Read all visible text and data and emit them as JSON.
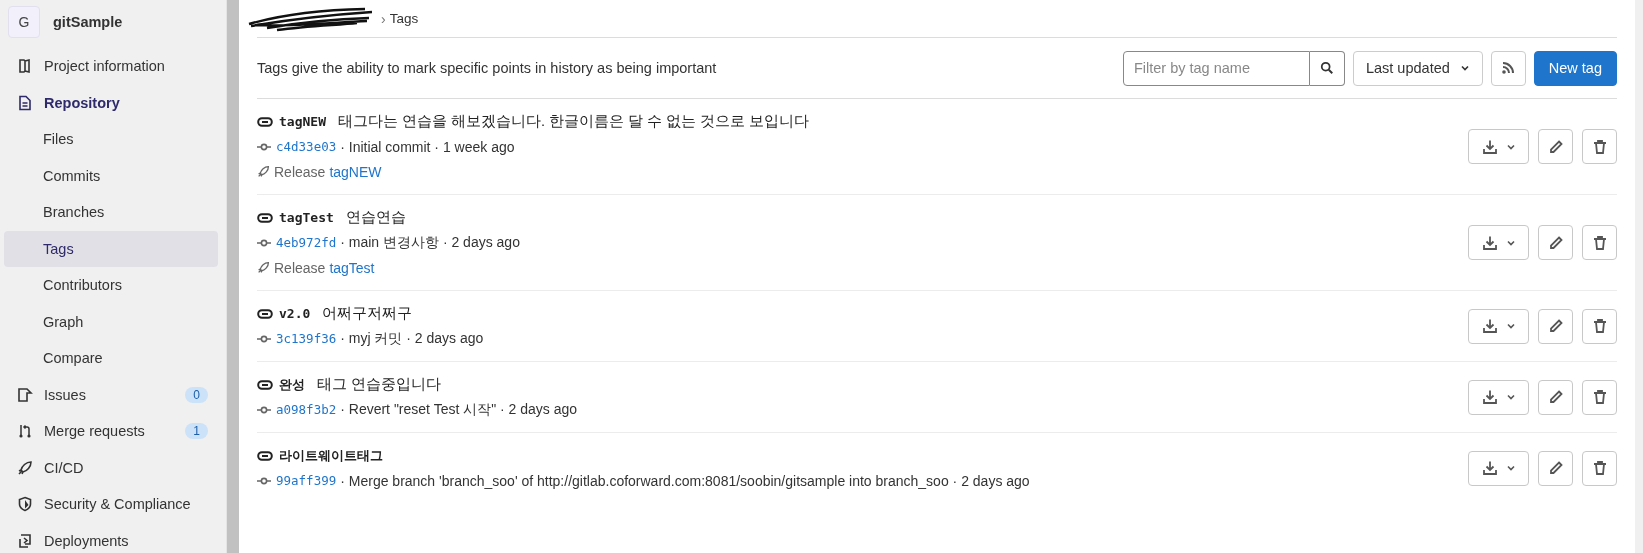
{
  "sidebar": {
    "project": {
      "avatar": "G",
      "name": "gitSample"
    },
    "items": [
      {
        "label": "Project information",
        "selected": false
      },
      {
        "label": "Repository",
        "selected": true,
        "children": [
          {
            "label": "Files",
            "selected": false
          },
          {
            "label": "Commits",
            "selected": false
          },
          {
            "label": "Branches",
            "selected": false
          },
          {
            "label": "Tags",
            "selected": true
          },
          {
            "label": "Contributors",
            "selected": false
          },
          {
            "label": "Graph",
            "selected": false
          },
          {
            "label": "Compare",
            "selected": false
          }
        ]
      },
      {
        "label": "Issues",
        "selected": false,
        "badge": "0"
      },
      {
        "label": "Merge requests",
        "selected": false,
        "badge": "1"
      },
      {
        "label": "CI/CD",
        "selected": false
      },
      {
        "label": "Security & Compliance",
        "selected": false
      },
      {
        "label": "Deployments",
        "selected": false
      }
    ]
  },
  "breadcrumb": {
    "separator": "›",
    "current": "Tags"
  },
  "description": "Tags give the ability to mark specific points in history as being important",
  "filter": {
    "placeholder": "Filter by tag name"
  },
  "sort": {
    "label": "Last updated"
  },
  "new_button": "New tag",
  "tags": [
    {
      "name": "tagNEW",
      "message": "태그다는 연습을 해보겠습니다. 한글이름은 달 수 없는 것으로 보입니다",
      "sha": "c4d33e03",
      "commit_text": "· Initial commit · 1 week ago",
      "release": {
        "label": "Release",
        "tag": "tagNEW"
      }
    },
    {
      "name": "tagTest",
      "message": "연습연습",
      "sha": "4eb972fd",
      "commit_text": "· main 변경사항 · 2 days ago",
      "release": {
        "label": "Release",
        "tag": "tagTest"
      }
    },
    {
      "name": "v2.0",
      "message": "어쩌구저쩌구",
      "sha": "3c139f36",
      "commit_text": "· myj 커밋 · 2 days ago"
    },
    {
      "name": "완성",
      "message": "태그 연습중입니다",
      "sha": "a098f3b2",
      "commit_text": "· Revert \"reset Test 시작\" · 2 days ago"
    },
    {
      "name": "라이트웨이트태그",
      "sha": "99aff399",
      "commit_text": "· Merge branch 'branch_soo' of http://gitlab.coforward.com:8081/soobin/gitsample into branch_soo · 2 days ago"
    }
  ]
}
